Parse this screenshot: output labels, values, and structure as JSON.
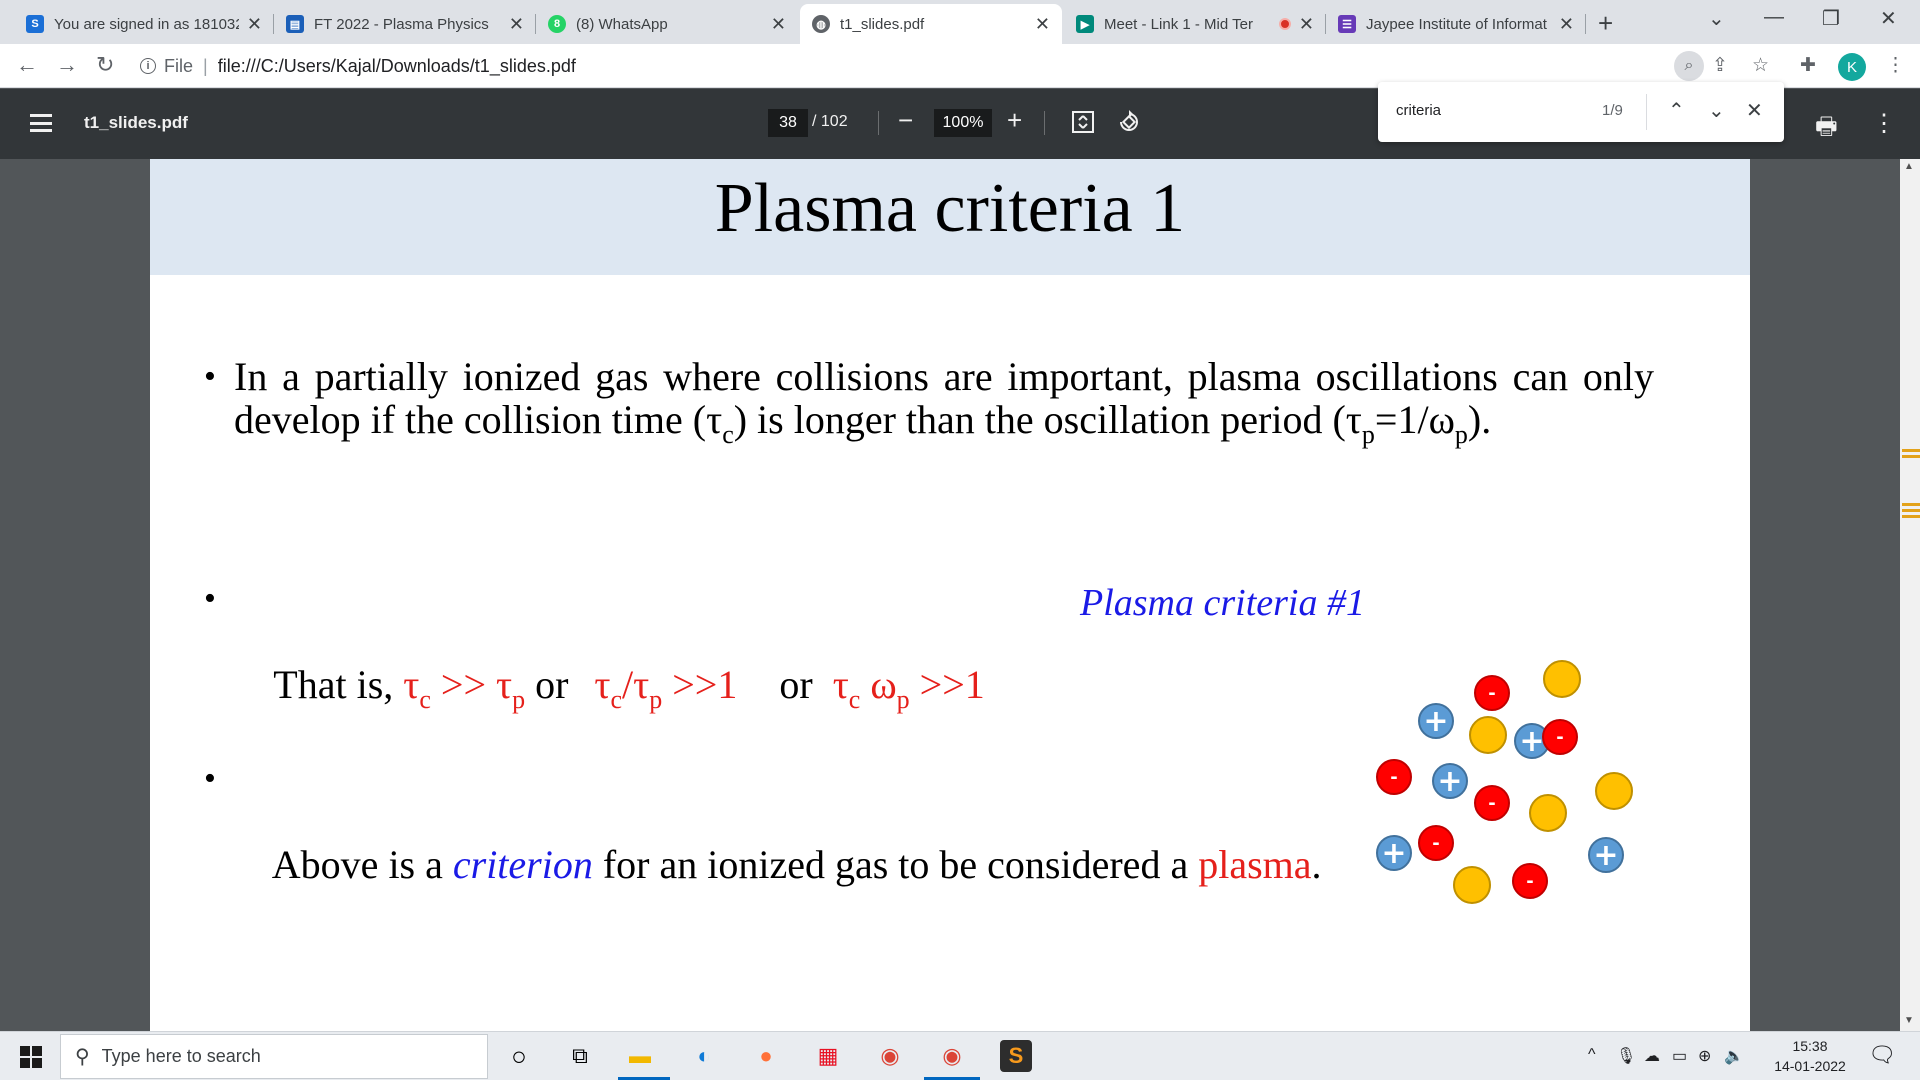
{
  "tabs": [
    {
      "title": "You are signed in as 181032",
      "favicon": "S",
      "favicon_color": "#1b6fd6"
    },
    {
      "title": "FT 2022 - Plasma Physics",
      "favicon": "C",
      "favicon_color": "#1b5fb8"
    },
    {
      "title": "(8) WhatsApp",
      "favicon": "8",
      "favicon_color": "#25d366"
    },
    {
      "title": "t1_slides.pdf",
      "favicon": "globe",
      "favicon_color": "#5f6368"
    },
    {
      "title": "Meet - Link 1 - Mid Ter",
      "favicon": "M",
      "favicon_color": "#00897b"
    },
    {
      "title": "Jaypee Institute of Informat",
      "favicon": "F",
      "favicon_color": "#673ab7"
    }
  ],
  "address": {
    "scheme": "File",
    "url": "file:///C:/Users/Kajal/Downloads/t1_slides.pdf"
  },
  "profile_initial": "K",
  "pdf": {
    "filename": "t1_slides.pdf",
    "current_page": "38",
    "total_pages": "/ 102",
    "zoom": "100%"
  },
  "find": {
    "query": "criteria",
    "count": "1/9"
  },
  "slide": {
    "title": "Plasma criteria 1",
    "bullet1": {
      "line1": "In a partially ionized gas where collisions are important, plasma oscillations can only",
      "line2_pre": "develop if the collision time (τ",
      "line2_sub1": "c",
      "line2_mid": ") is longer than the oscillation period (τ",
      "line2_sub2": "p",
      "line2_mid2": "=1/ω",
      "line2_sub3": "p",
      "line2_end": ")."
    },
    "bullet2": {
      "pre": "That is, ",
      "t1": "τ",
      "t1s": "c",
      "op1": " >> ",
      "t2": "τ",
      "t2s": "p",
      "or1": " or ",
      "r1": "τ",
      "r1s": "c",
      "r2": "/τ",
      "r2s": "p",
      "r3": " >>1",
      "or2": "or ",
      "w1": "τ",
      "w1s": "c",
      "w2": " ω",
      "w2s": "p",
      "w3": " >>1"
    },
    "plasma_criteria_label": "Plasma criteria #1",
    "bullet3": {
      "pre": "Above is a ",
      "criterion": "criterion",
      "mid": " for an ionized gas to be considered a ",
      "plasma": "plasma",
      "end": "."
    },
    "particles": {
      "positive_sign": "+",
      "negative_sign": "-",
      "positive_color": "#5b9bd5",
      "negative_color": "#ff0000",
      "neutral_color": "#ffc000"
    }
  },
  "taskbar": {
    "search_placeholder": "Type here to search",
    "time": "15:38",
    "date": "14-01-2022"
  }
}
